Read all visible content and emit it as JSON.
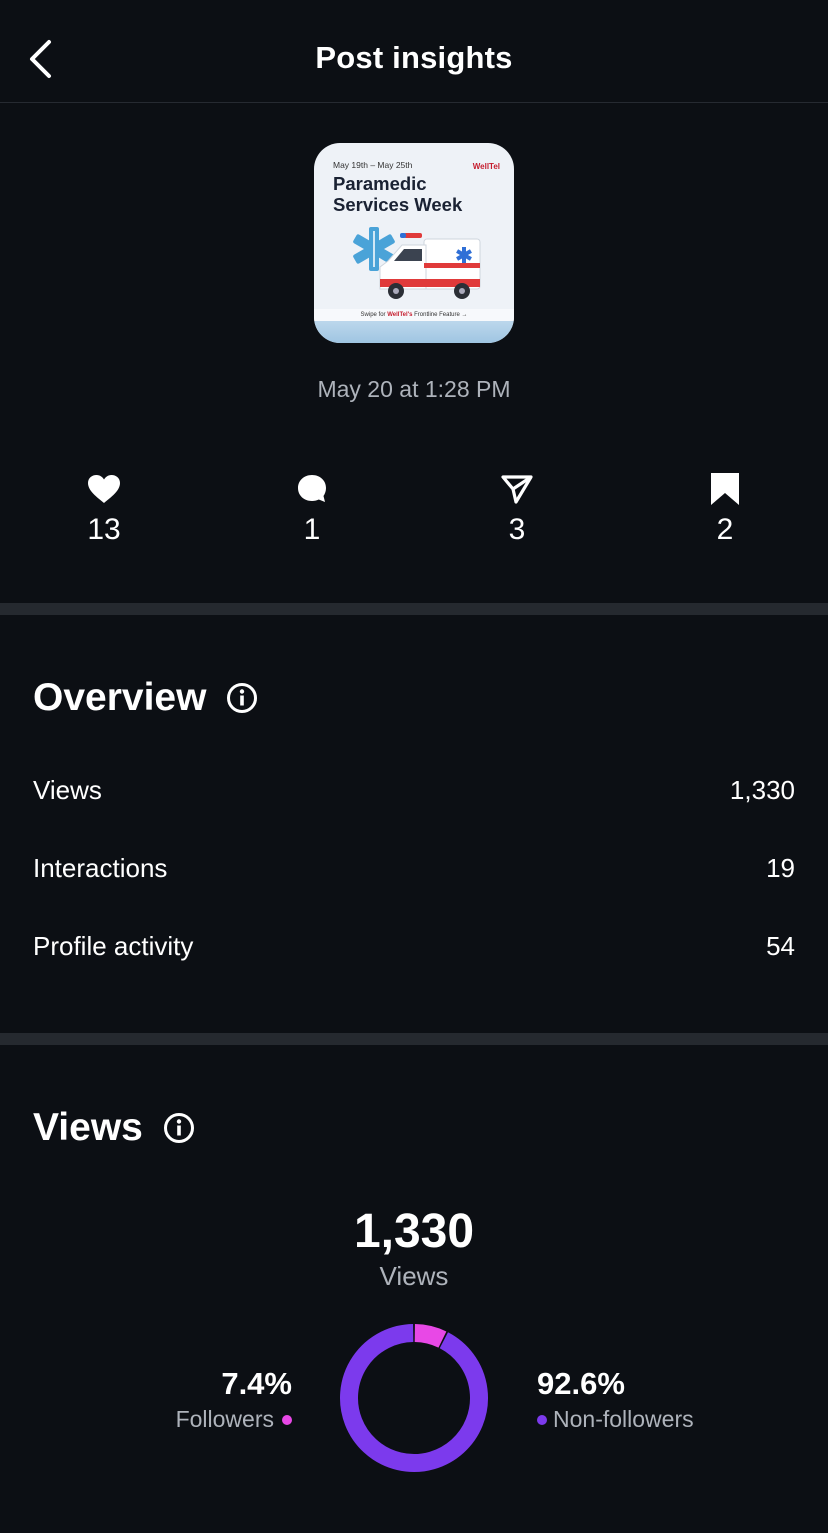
{
  "header": {
    "title": "Post insights",
    "back_icon": "chevron-left-icon"
  },
  "post": {
    "date": "May 20 at 1:28 PM",
    "thumbnail": {
      "date_range": "May 19th – May 25th",
      "brand": "WellTel",
      "title_line1": "Paramedic",
      "title_line2": "Services Week",
      "footer_prefix": "Swipe for ",
      "footer_brand": "WellTel's",
      "footer_suffix": " Frontline Feature →"
    }
  },
  "stats": [
    {
      "icon": "heart-icon",
      "value": "13"
    },
    {
      "icon": "comment-icon",
      "value": "1"
    },
    {
      "icon": "share-icon",
      "value": "3"
    },
    {
      "icon": "bookmark-icon",
      "value": "2"
    }
  ],
  "overview": {
    "title": "Overview",
    "rows": [
      {
        "label": "Views",
        "value": "1,330"
      },
      {
        "label": "Interactions",
        "value": "19"
      },
      {
        "label": "Profile activity",
        "value": "54"
      }
    ]
  },
  "views": {
    "title": "Views",
    "total": "1,330",
    "total_label": "Views",
    "followers_pct": "7.4%",
    "followers_label": "Followers",
    "non_followers_pct": "92.6%",
    "non_followers_label": "Non-followers"
  },
  "chart_data": {
    "type": "pie",
    "categories": [
      "Followers",
      "Non-followers"
    ],
    "values": [
      7.4,
      92.6
    ],
    "colors": [
      "#e848e6",
      "#7c3aed"
    ]
  }
}
